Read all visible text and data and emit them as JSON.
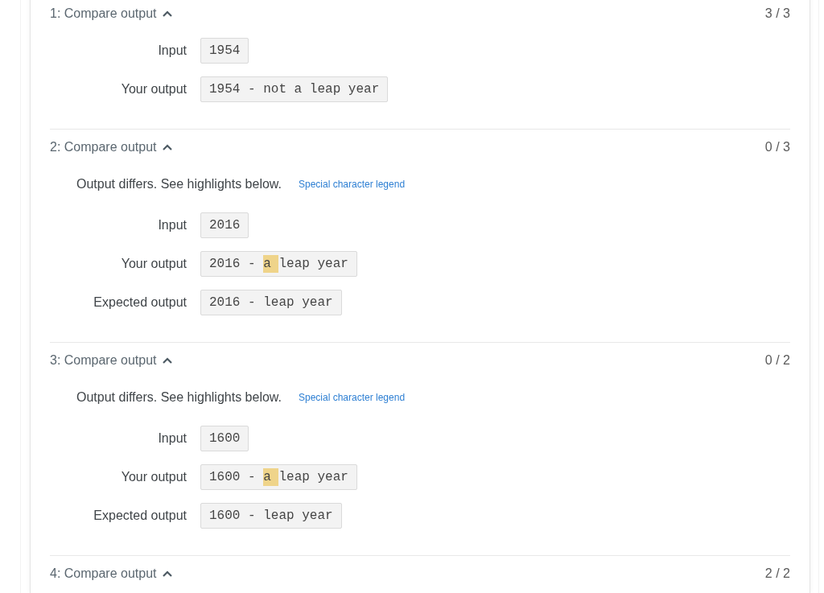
{
  "sections": [
    {
      "title": "1: Compare output",
      "expanded": true,
      "score": "3 / 3",
      "rows": [
        {
          "label": "Input",
          "segments": [
            {
              "text": "1954",
              "highlighted": false
            }
          ]
        },
        {
          "label": "Your output",
          "segments": [
            {
              "text": "1954 - not a leap year",
              "highlighted": false
            }
          ]
        }
      ]
    },
    {
      "title": "2: Compare output",
      "expanded": true,
      "score": "0 / 3",
      "message": "Output differs. See highlights below.",
      "legend_link": "Special character legend",
      "rows": [
        {
          "label": "Input",
          "segments": [
            {
              "text": "2016",
              "highlighted": false
            }
          ]
        },
        {
          "label": "Your output",
          "segments": [
            {
              "text": "2016 - ",
              "highlighted": false
            },
            {
              "text": "a ",
              "highlighted": true
            },
            {
              "text": "leap year",
              "highlighted": false
            }
          ]
        },
        {
          "label": "Expected output",
          "segments": [
            {
              "text": "2016 - leap year",
              "highlighted": false
            }
          ]
        }
      ]
    },
    {
      "title": "3: Compare output",
      "expanded": true,
      "score": "0 / 2",
      "message": "Output differs. See highlights below.",
      "legend_link": "Special character legend",
      "rows": [
        {
          "label": "Input",
          "segments": [
            {
              "text": "1600",
              "highlighted": false
            }
          ]
        },
        {
          "label": "Your output",
          "segments": [
            {
              "text": "1600 - ",
              "highlighted": false
            },
            {
              "text": "a ",
              "highlighted": true
            },
            {
              "text": "leap year",
              "highlighted": false
            }
          ]
        },
        {
          "label": "Expected output",
          "segments": [
            {
              "text": "1600 - leap year",
              "highlighted": false
            }
          ]
        }
      ]
    },
    {
      "title": "4: Compare output",
      "expanded": true,
      "score": "2 / 2"
    }
  ]
}
